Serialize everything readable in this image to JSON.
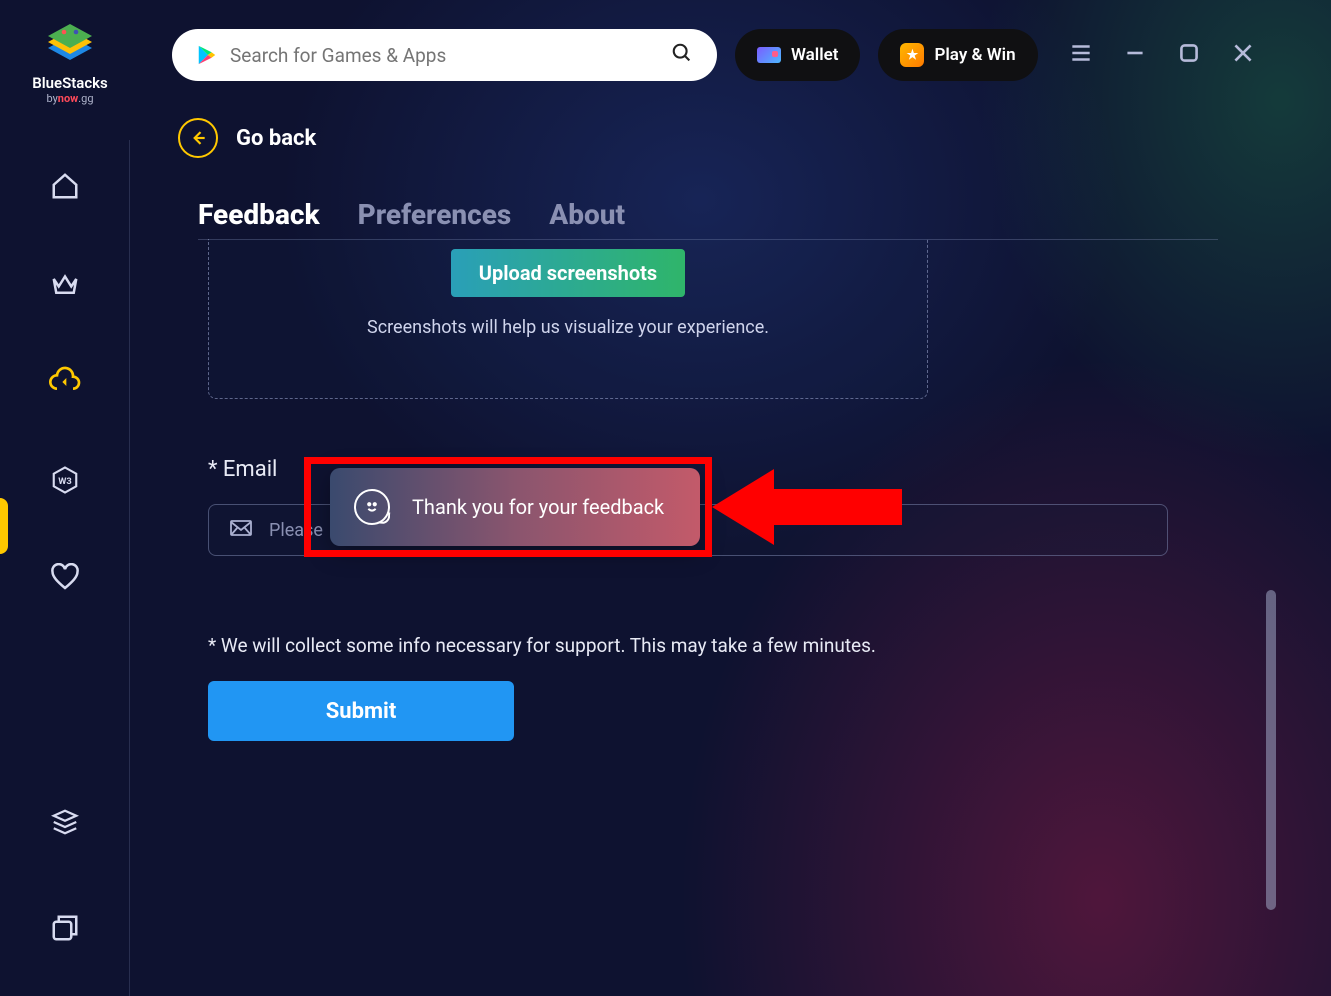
{
  "brand": {
    "name": "BlueStacks",
    "subline_prefix": "by",
    "subline_brand": "now",
    "subline_suffix": ".gg"
  },
  "search": {
    "placeholder": "Search for Games & Apps"
  },
  "header": {
    "wallet": "Wallet",
    "playwin": "Play & Win"
  },
  "goback": {
    "label": "Go back"
  },
  "tabs": {
    "feedback": "Feedback",
    "preferences": "Preferences",
    "about": "About"
  },
  "upload": {
    "button": "Upload screenshots",
    "hint": "Screenshots will help us visualize your experience."
  },
  "email": {
    "label": "* Email",
    "placeholder": "Please"
  },
  "disclaimer": "* We will collect some info necessary for support. This may take a few minutes.",
  "submit": "Submit",
  "toast": "Thank you for your feedback"
}
